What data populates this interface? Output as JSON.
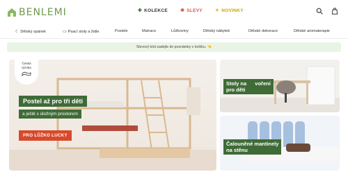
{
  "brand": {
    "name": "BENLEMI"
  },
  "topnav": [
    {
      "label": "KOLEKCE",
      "icon": "plus-icon"
    },
    {
      "label": "SLEVY",
      "icon": "sale-icon"
    },
    {
      "label": "NOVINKY",
      "icon": "star-icon"
    }
  ],
  "categories": [
    "Dětský spánek",
    "Psací stoly a židle",
    "Postele",
    "Matrace",
    "Lůžkoviny",
    "Dětský nábytek",
    "Dětské dekorace",
    "Dětské aromaterapie"
  ],
  "promo": {
    "text": "Slevový kód zadejte do poznámky v košíku. 👈"
  },
  "hero": {
    "badge_line1": "Česká",
    "badge_line2": "výroba",
    "title": "Postel až pro tři děti",
    "subtitle": "a ještě s úložným prostorem",
    "button": "PRO LŮŽKO LUCKY"
  },
  "cards": [
    {
      "line1": "Stoly na",
      "line1b": "voření",
      "line2": "pro děti"
    },
    {
      "line1": "Čalouněné mantinely",
      "line2": "na stěnu"
    }
  ],
  "colors": {
    "brand_green": "#6f9a4e",
    "dark_green": "#3f6b37",
    "cta_red": "#d8492b",
    "promo_bg": "#eaf4e4"
  }
}
